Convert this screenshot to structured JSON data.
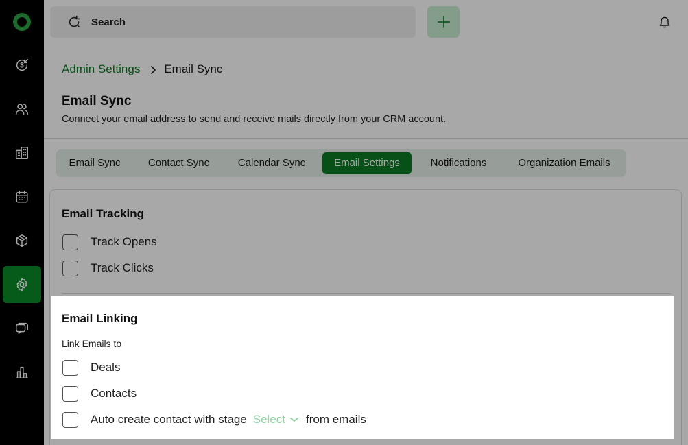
{
  "search": {
    "label": "Search"
  },
  "breadcrumb": {
    "parent": "Admin Settings",
    "current": "Email Sync"
  },
  "page": {
    "title": "Email Sync",
    "subtitle": "Connect your email address to send and receive mails directly from your CRM account."
  },
  "tabs": [
    {
      "label": "Email Sync"
    },
    {
      "label": "Contact Sync"
    },
    {
      "label": "Calendar Sync"
    },
    {
      "label": "Email Settings",
      "active": true
    },
    {
      "label": "Notifications"
    },
    {
      "label": "Organization Emails"
    }
  ],
  "tracking": {
    "title": "Email Tracking",
    "options": [
      {
        "label": "Track Opens",
        "checked": false
      },
      {
        "label": "Track Clicks",
        "checked": false
      }
    ]
  },
  "linking": {
    "title": "Email Linking",
    "subtitle": "Link Emails to",
    "options": [
      {
        "label": "Deals",
        "checked": false
      },
      {
        "label": "Contacts",
        "checked": false
      }
    ],
    "auto_create": {
      "label": "Auto create contact with stage",
      "select_value": "Select",
      "suffix": "from emails",
      "checked": false
    }
  },
  "colors": {
    "brand_green": "#0b7a23",
    "sidebar_bg": "#000000",
    "tabs_bg": "#e5efe8",
    "select_text": "#8fd4a3"
  },
  "icons": {
    "sidebar": [
      "deals-dollar-icon",
      "contacts-icon",
      "company-building-icon",
      "calendar-icon",
      "products-box-icon",
      "settings-gear-icon",
      "chat-icon",
      "reports-chart-icon"
    ],
    "topbar": [
      "search-refresh-icon",
      "plus-icon",
      "bell-icon"
    ]
  }
}
